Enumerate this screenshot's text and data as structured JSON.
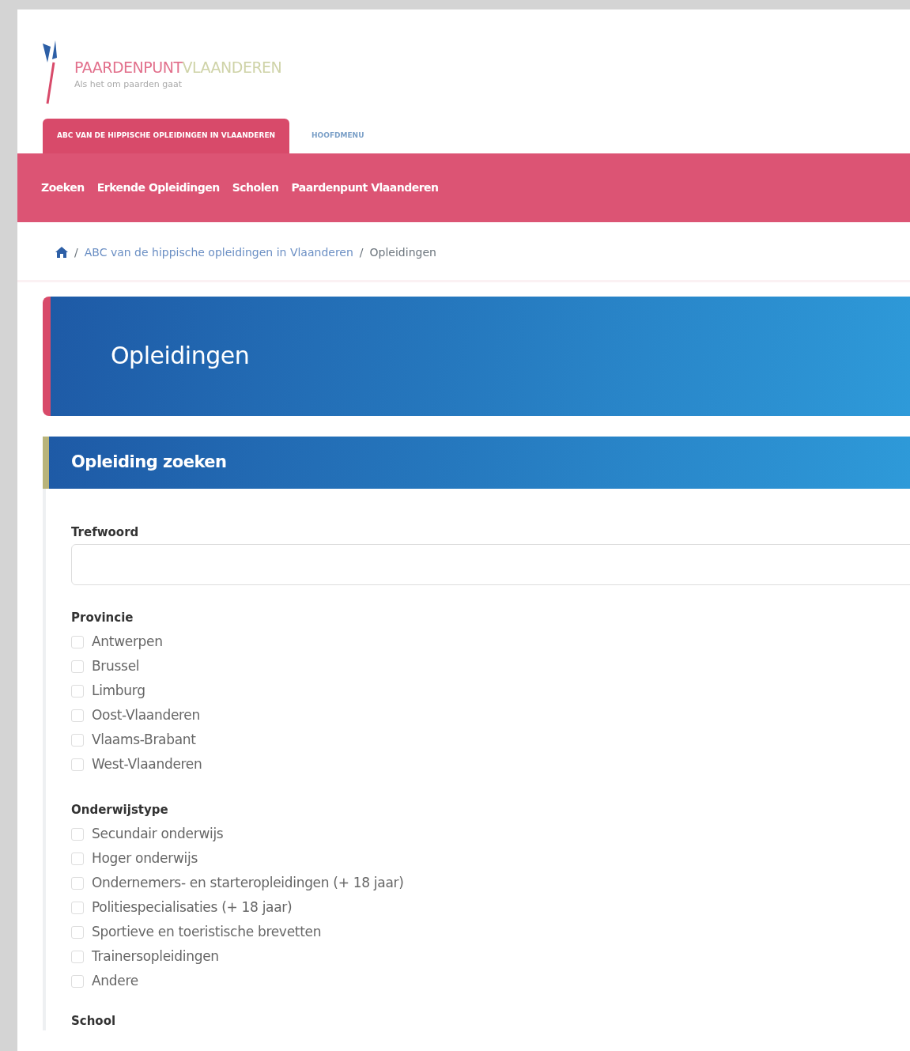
{
  "logo": {
    "name_part_1": "PAARDENPUNT",
    "name_part_2": "VLAANDEREN",
    "tagline": "Als het om paarden gaat"
  },
  "tabs": [
    {
      "label": "ABC VAN DE HIPPISCHE OPLEIDINGEN IN VLAANDEREN",
      "selected": true
    },
    {
      "label": "HOOFDMENU",
      "selected": false
    }
  ],
  "menu": [
    "Zoeken",
    "Erkende Opleidingen",
    "Scholen",
    "Paardenpunt Vlaanderen"
  ],
  "breadcrumb_separator": "/",
  "breadcrumb": [
    "ABC van de hippische opleidingen in Vlaanderen",
    "Opleidingen"
  ],
  "page_title": "Opleidingen",
  "search_panel": {
    "title": "Opleiding zoeken",
    "keyword_field": {
      "label": "Trefwoord"
    },
    "groups": [
      {
        "label": "Provincie",
        "options": [
          {
            "label": "Antwerpen",
            "checked": false
          },
          {
            "label": "Brussel",
            "checked": false
          },
          {
            "label": "Limburg",
            "checked": false
          },
          {
            "label": "Oost-Vlaanderen",
            "checked": false
          },
          {
            "label": "Vlaams-Brabant",
            "checked": false
          },
          {
            "label": "West-Vlaanderen",
            "checked": false
          }
        ]
      },
      {
        "label": "Onderwijstype",
        "options": [
          {
            "label": "Secundair onderwijs",
            "checked": false
          },
          {
            "label": "Hoger onderwijs",
            "checked": false
          },
          {
            "label": "Ondernemers- en starteropleidingen (+ 18 jaar)",
            "checked": false
          },
          {
            "label": "Politiespecialisaties (+ 18 jaar)",
            "checked": false
          },
          {
            "label": "Sportieve en toeristische brevetten",
            "checked": false
          },
          {
            "label": "Trainersopleidingen",
            "checked": false
          },
          {
            "label": "Andere",
            "checked": false
          }
        ]
      }
    ],
    "next_label": "School"
  }
}
